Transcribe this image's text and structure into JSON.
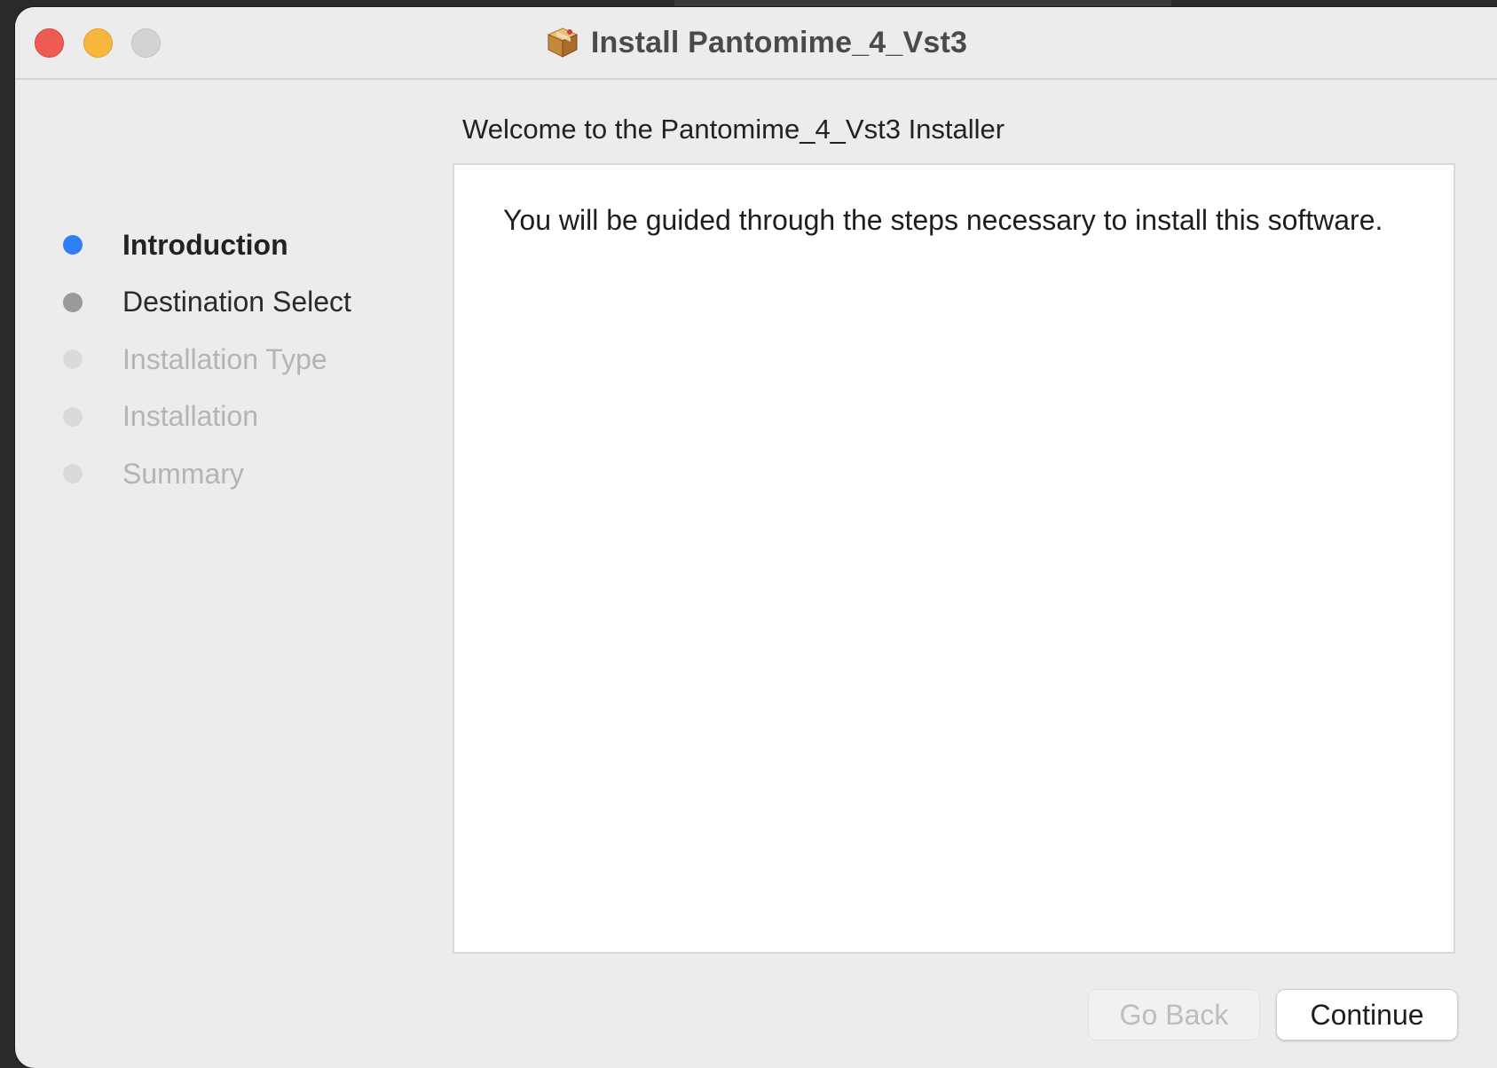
{
  "window": {
    "title": "Install Pantomime_4_Vst3",
    "title_icon": "package-icon",
    "controls": [
      "close",
      "minimize",
      "zoom"
    ]
  },
  "heading": "Welcome to the Pantomime_4_Vst3 Installer",
  "steps": [
    {
      "label": "Introduction",
      "state": "current"
    },
    {
      "label": "Destination Select",
      "state": "next"
    },
    {
      "label": "Installation Type",
      "state": "future"
    },
    {
      "label": "Installation",
      "state": "future"
    },
    {
      "label": "Summary",
      "state": "future"
    }
  ],
  "content": {
    "body": "You will be guided through the steps necessary to install this software."
  },
  "buttons": {
    "go_back": {
      "label": "Go Back",
      "enabled": false
    },
    "continue": {
      "label": "Continue",
      "enabled": true
    }
  },
  "colors": {
    "close": "#ee5b53",
    "minimize": "#f6b73c",
    "zoom_inactive": "#d3d3d3",
    "current_step": "#2f7ff6",
    "next_step": "#9a9a9a",
    "future_step": "#dadada"
  }
}
